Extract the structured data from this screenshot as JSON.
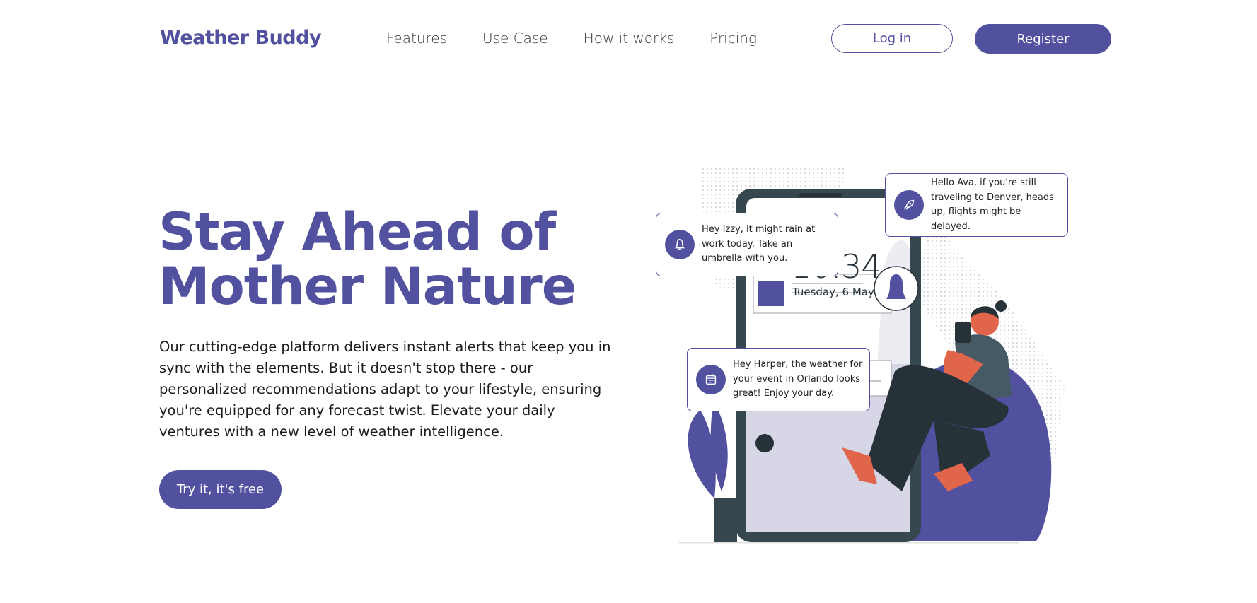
{
  "brand": {
    "name": "Weather Buddy"
  },
  "nav": {
    "items": [
      {
        "label": "Features"
      },
      {
        "label": "Use Case"
      },
      {
        "label": "How it works"
      },
      {
        "label": "Pricing"
      }
    ]
  },
  "auth": {
    "login_label": "Log in",
    "register_label": "Register"
  },
  "hero": {
    "title_line1": "Stay Ahead of",
    "title_line2": "Mother Nature",
    "description": "Our cutting-edge platform delivers instant alerts that keep you in sync with the elements. But it doesn't stop there - our personalized recommendations adapt to your lifestyle, ensuring you're equipped for any forecast twist. Elevate your daily ventures with a new level of weather intelligence.",
    "cta_label": "Try it, it's free"
  },
  "illustration": {
    "clock": "10:34",
    "date": "Tuesday, 6 May",
    "notifications": [
      {
        "icon": "bell-icon",
        "text": "Hey Izzy, it might rain at work today. Take an umbrella with you."
      },
      {
        "icon": "rocket-icon",
        "text": "Hello Ava, if you're still traveling to Denver, heads up, flights might be delayed."
      },
      {
        "icon": "calendar-icon",
        "text": "Hey Harper, the weather for your event in Orlando looks great! Enjoy your day."
      }
    ]
  },
  "colors": {
    "accent": "#5251a0",
    "dark": "#263238",
    "skin": "#e0654b",
    "light": "#d6d6e6"
  }
}
